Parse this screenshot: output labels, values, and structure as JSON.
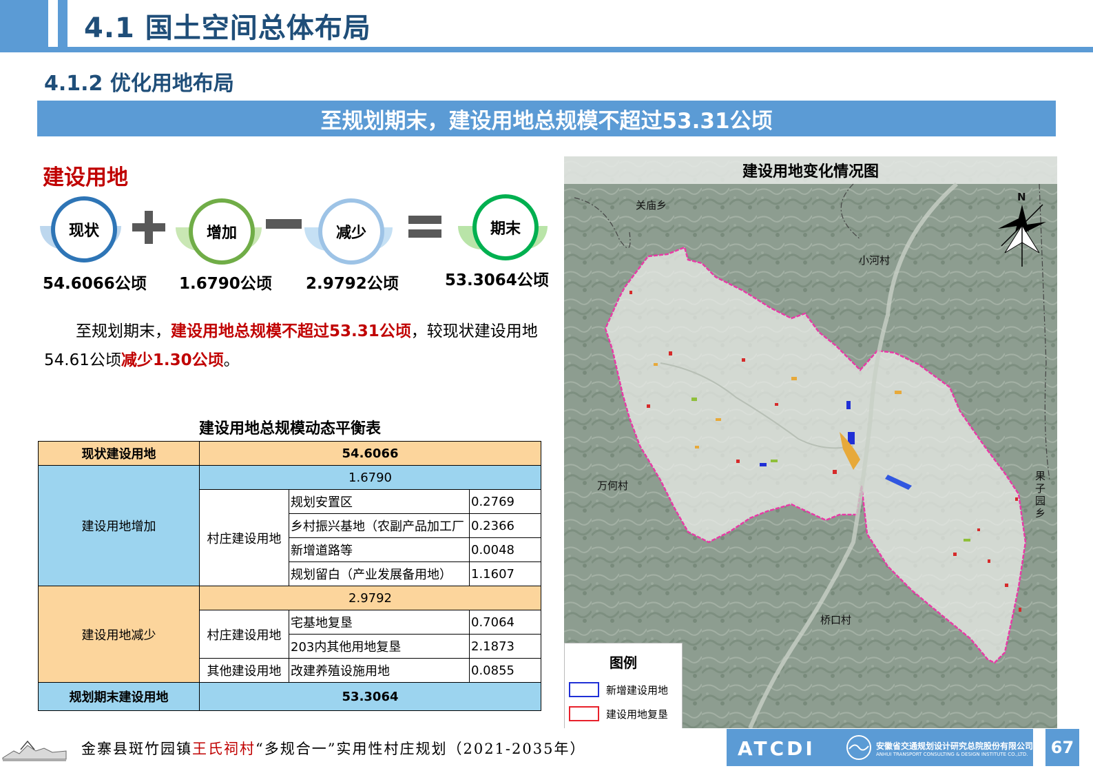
{
  "header": {
    "title": "4.1 国土空间总体布局",
    "subtitle": "4.1.2 优化用地布局",
    "banner": "至规划期末，建设用地总规模不超过53.31公顷"
  },
  "formula": {
    "section_title": "建设用地",
    "terms": [
      {
        "label": "现状",
        "value": "54.6066公顷",
        "color": "#2e75b6"
      },
      {
        "label": "增加",
        "value": "1.6790公顷",
        "color": "#70ad47"
      },
      {
        "label": "减少",
        "value": "2.9792公顷",
        "color": "#9dc3e6"
      },
      {
        "label": "期末",
        "value": "53.3064公顷",
        "color": "#00b050"
      }
    ],
    "operators": [
      "+",
      "−",
      "="
    ]
  },
  "paragraph": {
    "p1": "至规划期末，",
    "p2": "建设用地总规模不超过53.31公顷",
    "p3": "，较现状建设用地54.61公顷",
    "p4": "减少1.30公顷",
    "p5": "。"
  },
  "table": {
    "title": "建设用地总规模动态平衡表",
    "current_label": "现状建设用地",
    "current_value": "54.6066",
    "increase": {
      "label": "建设用地增加",
      "total": "1.6790",
      "group": "村庄建设用地",
      "rows": [
        {
          "item": "规划安置区",
          "value": "0.2769"
        },
        {
          "item": "乡村振兴基地（农副产品加工厂",
          "value": "0.2366"
        },
        {
          "item": "新增道路等",
          "value": "0.0048"
        },
        {
          "item": "规划留白（产业发展备用地）",
          "value": "1.1607"
        }
      ]
    },
    "decrease": {
      "label": "建设用地减少",
      "total": "2.9792",
      "group1": "村庄建设用地",
      "rows1": [
        {
          "item": "宅基地复垦",
          "value": "0.7064"
        },
        {
          "item": "203内其他用地复垦",
          "value": "2.1873"
        }
      ],
      "group2": "其他建设用地",
      "rows2": [
        {
          "item": "改建养殖设施用地",
          "value": "0.0855"
        }
      ]
    },
    "final_label": "规划期末建设用地",
    "final_value": "53.3064"
  },
  "map": {
    "title": "建设用地变化情况图",
    "north": "N",
    "places": {
      "guanmiao": "关庙乡",
      "xiaohe": "小河村",
      "wanhe": "万何村",
      "qiaokou": "桥口村",
      "guoziyuan": "果子园乡"
    },
    "legend": {
      "title": "图例",
      "items": [
        {
          "label": "新增建设用地",
          "color": "#1f2fd6"
        },
        {
          "label": "建设用地复垦",
          "color": "#e8202a"
        }
      ]
    },
    "boundary_color": "#e83aa6"
  },
  "footer": {
    "left": "金寨县斑竹园镇",
    "highlight": "王氏祠村",
    "right": "“多规合一”实用性村庄规划（2021-2035年）",
    "org_mark": "ATCDI",
    "org_name": "安徽省交通规划设计研究总院股份有限公司",
    "org_en": "ANHUI TRANSPORT CONSULTING & DESIGN INSTITUTE CO.,LTD.",
    "page": "67"
  },
  "colors": {
    "accent": "#5b9bd5",
    "title": "#1f4e79",
    "emphasis": "#c00000",
    "table_orange": "#fcd59c",
    "table_blue": "#9cd4ef"
  }
}
